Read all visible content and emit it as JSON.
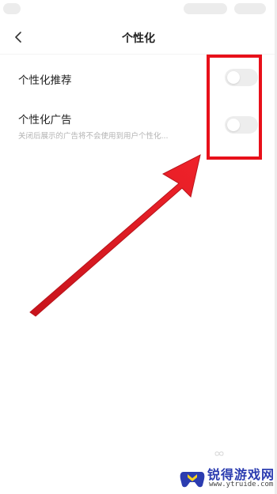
{
  "header": {
    "title": "个性化",
    "back_icon": "chevron-left-icon"
  },
  "settings": [
    {
      "label": "个性化推荐",
      "enabled": false
    },
    {
      "label": "个性化广告",
      "description": "关闭后展示的广告将不会使用到用户个性化...",
      "enabled": false
    }
  ],
  "annotation": {
    "color": "#e8101a"
  },
  "watermark": {
    "title": "锐得游戏网",
    "url": "www.ytruide.com"
  },
  "colors": {
    "toggle_off": "#ededed",
    "annotation_red": "#e8101a",
    "watermark_blue": "#2b3cb0"
  }
}
